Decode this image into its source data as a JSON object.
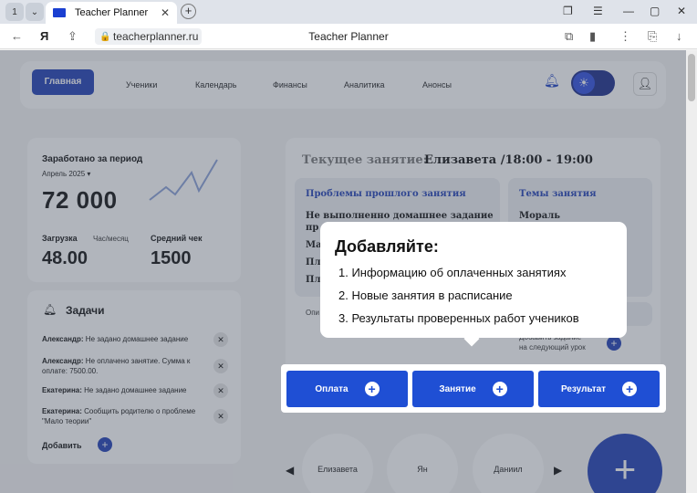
{
  "browser": {
    "tab_count": "1",
    "tab_title": "Teacher Planner",
    "url": "teacherplanner.ru",
    "page_title": "Teacher Planner"
  },
  "nav": {
    "home": "Главная",
    "items": [
      "Ученики",
      "Календарь",
      "Финансы",
      "Аналитика",
      "Анонсы"
    ]
  },
  "earnings": {
    "title": "Заработано за период",
    "period": "Апрель 2025",
    "amount": "72 000",
    "load_label": "Загрузка",
    "load_unit": "Час/месяц",
    "load_value": "48.00",
    "avg_label": "Средний чек",
    "avg_value": "1500"
  },
  "tasks": {
    "title": "Задачи",
    "items": [
      {
        "name": "Александр:",
        "text": " Не задано домашнее задание"
      },
      {
        "name": "Александр:",
        "text": " Не оплачено занятие. Сумма к оплате: 7500.00."
      },
      {
        "name": "Екатерина:",
        "text": " Не задано домашнее задание"
      },
      {
        "name": "Екатерина:",
        "text": " Сообщить родителю о проблеме \"Мало теории\""
      }
    ],
    "add_label": "Добавить"
  },
  "current_lesson": {
    "label": "Текущее занятие:",
    "value": "Елизавета /18:00 - 19:00",
    "problems_title": "Проблемы прошлого занятия",
    "problems": [
      "Не выполненно домашнее задание",
      "пр",
      "Ма",
      "Пл",
      "Пл"
    ],
    "topics_title": "Темы занятия",
    "topics": [
      "Мораль"
    ],
    "partial_left": "Опи",
    "partial_right_1": "Добавить задание",
    "partial_right_2": "на следующий урок"
  },
  "students": [
    "Елизавета",
    "Ян",
    "Даниил"
  ],
  "tooltip": {
    "title": "Добавляйте:",
    "items": [
      "1. Информацию об оплаченных занятиях",
      "2. Новые занятия в расписание",
      "3. Результаты  проверенных работ учеников"
    ]
  },
  "actions": {
    "payment": "Оплата",
    "lesson": "Занятие",
    "result": "Результат"
  }
}
